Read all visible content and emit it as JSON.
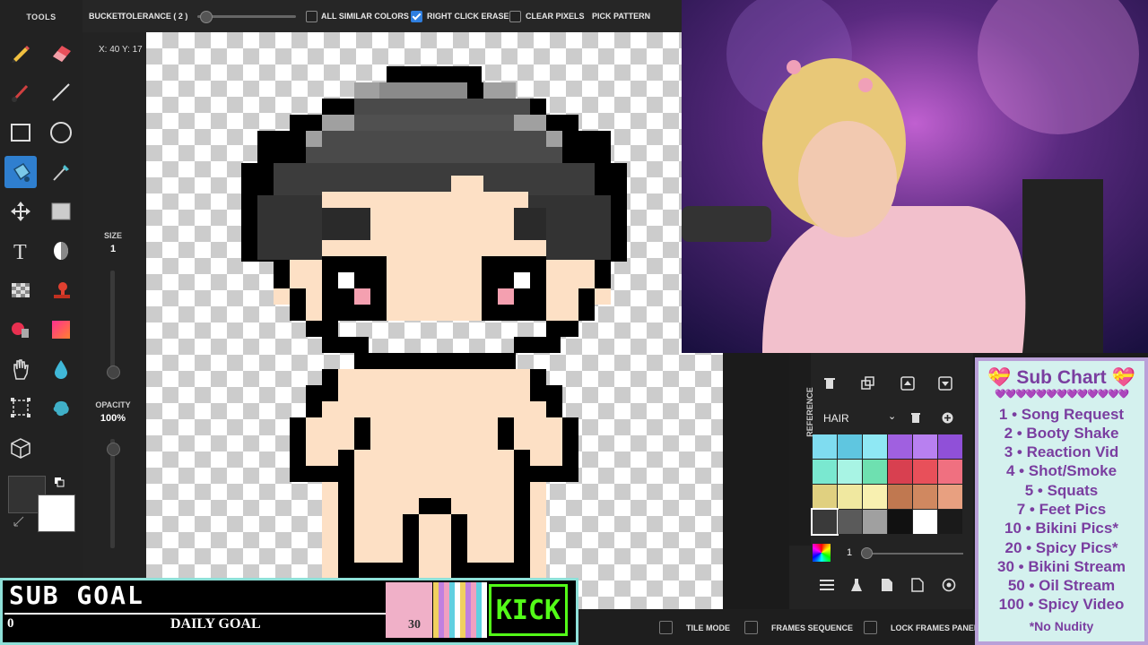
{
  "tools": {
    "title": "TOOLS"
  },
  "brush": {
    "size_label": "SIZE",
    "size_value": "1",
    "opacity_label": "OPACITY",
    "opacity_value": "100%"
  },
  "toolbar": {
    "bucket_label": "BUCKET:",
    "tolerance_label": "TOLERANCE ( 2 )",
    "all_similar_colors": "ALL SIMILAR COLORS",
    "right_click_erase": "RIGHT CLICK ERASE",
    "clear_pixels": "CLEAR PIXELS",
    "pick_pattern": "PICK PATTERN"
  },
  "canvas": {
    "coords": "X: 40 Y: 17"
  },
  "reference_panel": {
    "reference_label": "REFERENCE",
    "palette_name": "HAIR",
    "opacity_value": "1",
    "swatches": [
      "#7fdcf0",
      "#5fc6e0",
      "#8fe8f4",
      "#a060e0",
      "#b880f0",
      "#9050d8",
      "#7ae8d0",
      "#a8f4e4",
      "#6ee0b0",
      "#d84050",
      "#e8505a",
      "#f07080",
      "#e0d080",
      "#f0e8a0",
      "#f8f0b0",
      "#c07850",
      "#d08860",
      "#e8a080",
      "#3a3a3a",
      "#5a5a5a",
      "#a0a0a0",
      "#111111",
      "#ffffff",
      "#1a1a1a"
    ]
  },
  "bottom_bar": {
    "tile_mode": "TILE MODE",
    "frames_sequence": "FRAMES SEQUENCE",
    "lock_frames_panel": "LOCK FRAMES PANEL"
  },
  "sub_goal": {
    "title": "SUB GOAL",
    "current": "0",
    "label": "DAILY GOAL",
    "target": "30",
    "progress": 0,
    "kick": "KICK"
  },
  "sub_chart": {
    "title": "💝 Sub Chart 💝",
    "hearts": "💜💜💜💜💜💜💜💜💜💜💜💜💜",
    "items": [
      "1 • Song Request",
      "2 • Booty Shake",
      "3 • Reaction Vid",
      "4 • Shot/Smoke",
      "5 • Squats",
      "7 • Feet Pics",
      "10 • Bikini Pics*",
      "20 • Spicy Pics*",
      "30 • Bikini Stream",
      "50 • Oil Stream",
      "100 • Spicy Video",
      "*No Nudity"
    ]
  },
  "colors": {
    "accent": "#2f7fcf",
    "kick_green": "#53fc18",
    "skin": "#fde0c5",
    "hair_dark": "#3a3a3a"
  }
}
